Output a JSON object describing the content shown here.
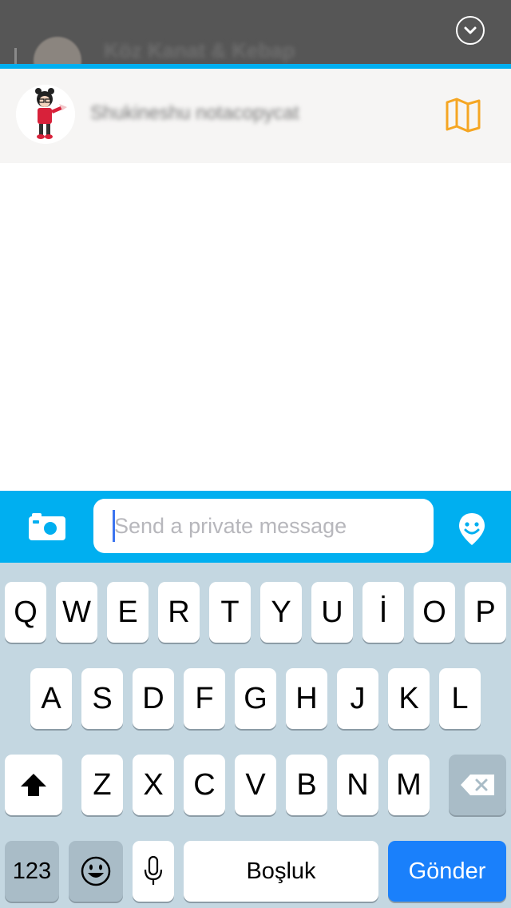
{
  "header": {
    "previous_chat_title": "Köz Kanat & Kebap",
    "collapse_icon": "chevron-down-circle-icon"
  },
  "contact": {
    "name": "Shukineshu notacopycat",
    "map_icon": "map-icon"
  },
  "composer": {
    "placeholder": "Send a private message",
    "value": "",
    "camera_icon": "camera-icon",
    "mood_icon": "smiley-pin-icon"
  },
  "keyboard": {
    "row1": [
      "Q",
      "W",
      "E",
      "R",
      "T",
      "Y",
      "U",
      "İ",
      "O",
      "P"
    ],
    "row2": [
      "A",
      "S",
      "D",
      "F",
      "G",
      "H",
      "J",
      "K",
      "L"
    ],
    "row3": [
      "Z",
      "X",
      "C",
      "V",
      "B",
      "N",
      "M"
    ],
    "numbers_label": "123",
    "space_label": "Boşluk",
    "send_label": "Gönder",
    "shift_icon": "shift-icon",
    "backspace_icon": "backspace-icon",
    "emoji_icon": "emoji-icon",
    "mic_icon": "microphone-icon"
  },
  "colors": {
    "accent": "#00aff0",
    "send": "#1a80fb",
    "map_icon": "#f5a623",
    "keyboard_bg": "#c4d7e1"
  }
}
